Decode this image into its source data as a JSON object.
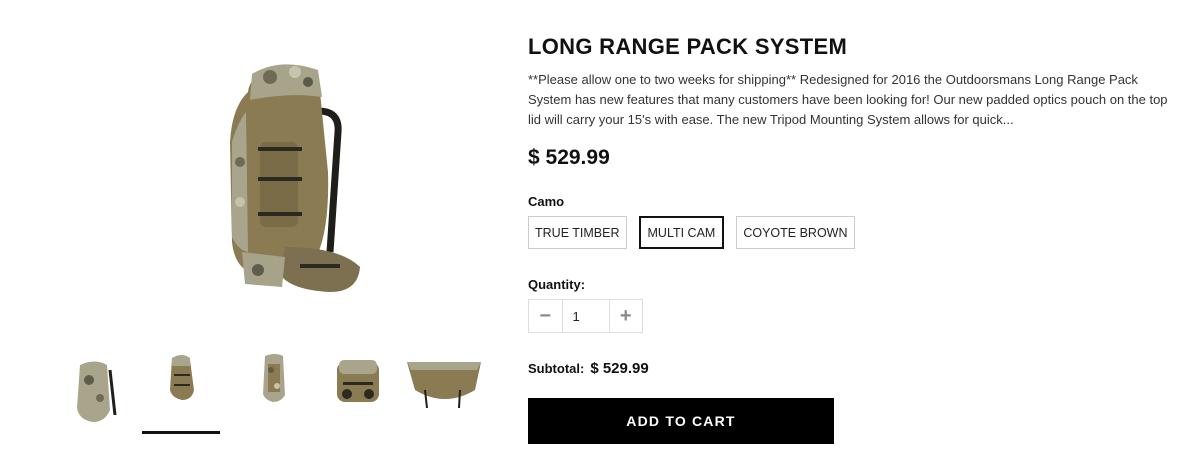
{
  "product": {
    "title": "LONG RANGE PACK SYSTEM",
    "description": "**Please allow one to two weeks for shipping** Redesigned for 2016 the Outdoorsmans Long Range Pack System has new features that many customers have been looking for! Our new padded optics pouch on the top lid will carry your 15's with ease. The new Tripod Mounting System allows for quick...",
    "price": "$ 529.99"
  },
  "options": {
    "label": "Camo",
    "variants": [
      "TRUE TIMBER",
      "MULTI CAM",
      "COYOTE BROWN"
    ],
    "selected": "MULTI CAM"
  },
  "quantity": {
    "label": "Quantity:",
    "value": "1",
    "minus": "−",
    "plus": "+"
  },
  "subtotal": {
    "label": "Subtotal:",
    "value": "$ 529.99"
  },
  "cart": {
    "button_label": "ADD TO CART"
  },
  "gallery": {
    "active_thumb": 2,
    "thumb_count": 5
  },
  "colors": {
    "pack_tan": "#8a7b52",
    "camo_light": "#b6b29a",
    "strap_dark": "#2a2a22",
    "button_bg": "#000000"
  }
}
